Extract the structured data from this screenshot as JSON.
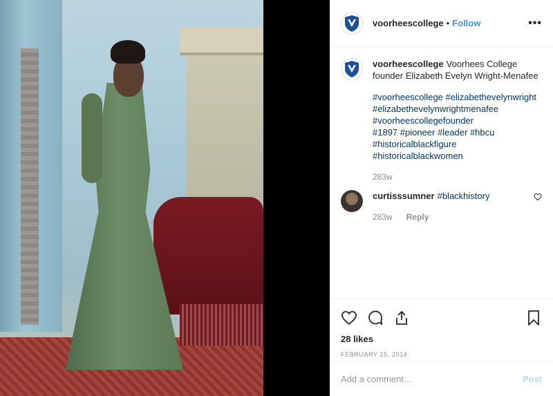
{
  "post": {
    "account": "voorheescollege",
    "follow_label": "Follow",
    "separator": "•",
    "more_label": "•••"
  },
  "caption": {
    "user": "voorheescollege",
    "text": "Voorhees College founder Elizabeth Evelyn Wright-Menafee",
    "hashtags": [
      "#voorheescollege #elizabethevelynwright",
      "#elizabethevelynwrightmenafee",
      "#voorheescollegefounder",
      "#1897 #pioneer #leader #hbcu",
      "#historicalblackfigure",
      "#historicalblackwomen"
    ],
    "time": "283w"
  },
  "comment": {
    "user": "curtisssumner",
    "text": "#blackhistory",
    "time": "283w",
    "reply_label": "Reply"
  },
  "stats": {
    "likes": "28 likes",
    "date": "FEBRUARY 25, 2014"
  },
  "add_comment": {
    "placeholder": "Add a comment…",
    "post_label": "Post"
  },
  "icons": {
    "logo": "voorhees-shield-logo",
    "like": "heart-icon",
    "comment": "comment-bubble-icon",
    "share": "share-icon",
    "save": "bookmark-icon",
    "comment_like": "small-heart-icon"
  },
  "colors": {
    "link": "#3897f0",
    "hashtag": "#003569",
    "muted": "#8e8e8e",
    "post_disabled": "#b3dbff",
    "brand": "#1d4f9a"
  }
}
